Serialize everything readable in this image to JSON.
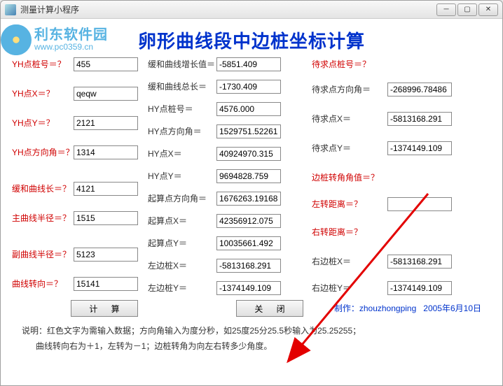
{
  "window": {
    "title": "测量计算小程序"
  },
  "watermark": {
    "brand": "利东软件园",
    "url": "www.pc0359.cn"
  },
  "header": {
    "title": "卵形曲线段中边桩坐标计算"
  },
  "col1": {
    "yh_stake_label": "YH点桩号＝？",
    "yh_stake_value": "455",
    "yh_x_label": "YH点X＝？",
    "yh_x_value": "qeqw",
    "yh_y_label": "YH点Y＝？",
    "yh_y_value": "2121",
    "yh_az_label": "YH点方向角＝？",
    "yh_az_value": "1314",
    "trans_len_label": "缓和曲线长＝？",
    "trans_len_value": "4121",
    "main_r_label": "主曲线半径＝？",
    "main_r_value": "1515",
    "sub_r_label": "副曲线半径＝？",
    "sub_r_value": "5123",
    "curve_dir_label": "曲线转向＝？",
    "curve_dir_value": "15141"
  },
  "col2": {
    "trans_inc_label": "缓和曲线增长值＝",
    "trans_inc_value": "-5851.409",
    "trans_total_label": "缓和曲线总长＝",
    "trans_total_value": "-1730.409",
    "hy_stake_label": "HY点桩号＝",
    "hy_stake_value": "4576.000",
    "hy_az_label": "HY点方向角＝",
    "hy_az_value": "1529751.52261",
    "hy_x_label": "HY点X＝",
    "hy_x_value": "40924970.315",
    "hy_y_label": "HY点Y＝",
    "hy_y_value": "9694828.759",
    "start_az_label": "起算点方向角＝",
    "start_az_value": "1676263.19168",
    "start_x_label": "起算点X＝",
    "start_x_value": "42356912.075",
    "start_y_label": "起算点Y＝",
    "start_y_value": "10035661.492",
    "left_x_label": "左边桩X＝",
    "left_x_value": "-5813168.291",
    "left_y_label": "左边桩Y＝",
    "left_y_value": "-1374149.109"
  },
  "col3": {
    "target_stake_label": "待求点桩号＝？",
    "target_az_label": "待求点方向角＝",
    "target_az_value": "-268996.78486",
    "target_x_label": "待求点X＝",
    "target_x_value": "-5813168.291",
    "target_y_label": "待求点Y＝",
    "target_y_value": "-1374149.109",
    "side_angle_label": "边桩转角角值＝？",
    "left_dist_label": "左转距离＝？",
    "left_dist_value": "",
    "right_dist_label": "右转距离＝？",
    "right_x_label": "右边桩X＝",
    "right_x_value": "-5813168.291",
    "right_y_label": "右边桩Y＝",
    "right_y_value": "-1374149.109"
  },
  "buttons": {
    "calc": "计  算",
    "close": "关  闭"
  },
  "credit": {
    "author": "制作：zhouzhongping",
    "date": "2005年6月10日"
  },
  "notes": {
    "prefix": "说明：",
    "line1": "红色文字为需输入数据；方向角输入为度分秒，如25度25分25.5秒输入为25.25255；",
    "line2": "曲线转向右为＋1，左转为－1；边桩转角为向左右转多少角度。"
  }
}
